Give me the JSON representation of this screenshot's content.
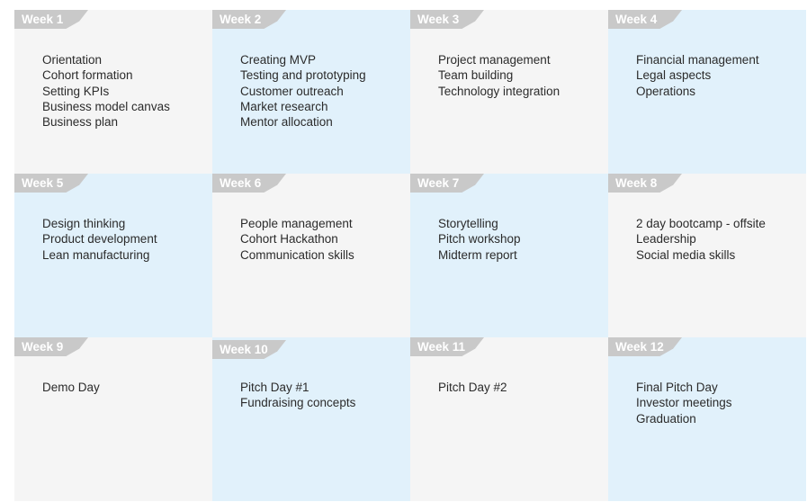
{
  "weeks": [
    {
      "label": "Week 1",
      "items": [
        "Orientation",
        "Cohort formation",
        "Setting KPIs",
        "Business model canvas",
        "Business plan"
      ]
    },
    {
      "label": "Week 2",
      "items": [
        "Creating MVP",
        "Testing and prototyping",
        "Customer outreach",
        "Market research",
        "Mentor allocation"
      ]
    },
    {
      "label": "Week 3",
      "items": [
        "Project management",
        "Team building",
        "Technology integration"
      ]
    },
    {
      "label": "Week 4",
      "items": [
        "Financial management",
        "Legal aspects",
        "Operations"
      ]
    },
    {
      "label": "Week 5",
      "items": [
        "Design thinking",
        "Product development",
        "Lean manufacturing"
      ]
    },
    {
      "label": "Week 6",
      "items": [
        "People management",
        "Cohort Hackathon",
        "Communication skills"
      ]
    },
    {
      "label": "Week 7",
      "items": [
        "Storytelling",
        "Pitch workshop",
        "Midterm report"
      ]
    },
    {
      "label": "Week 8",
      "items": [
        "2 day bootcamp - offsite",
        "Leadership",
        "Social media skills"
      ]
    },
    {
      "label": "Week 9",
      "items": [
        "Demo Day"
      ]
    },
    {
      "label": "Week 10",
      "items": [
        "Pitch Day #1",
        "Fundraising concepts"
      ]
    },
    {
      "label": "Week 11",
      "items": [
        "Pitch Day #2"
      ]
    },
    {
      "label": "Week 12",
      "items": [
        "Final Pitch Day",
        "Investor meetings",
        "Graduation"
      ]
    }
  ],
  "colors": {
    "gray_cell": "#f5f5f5",
    "blue_cell": "#e1f1fb",
    "tab": "#c9c9c9",
    "text": "#2b2b2b"
  }
}
